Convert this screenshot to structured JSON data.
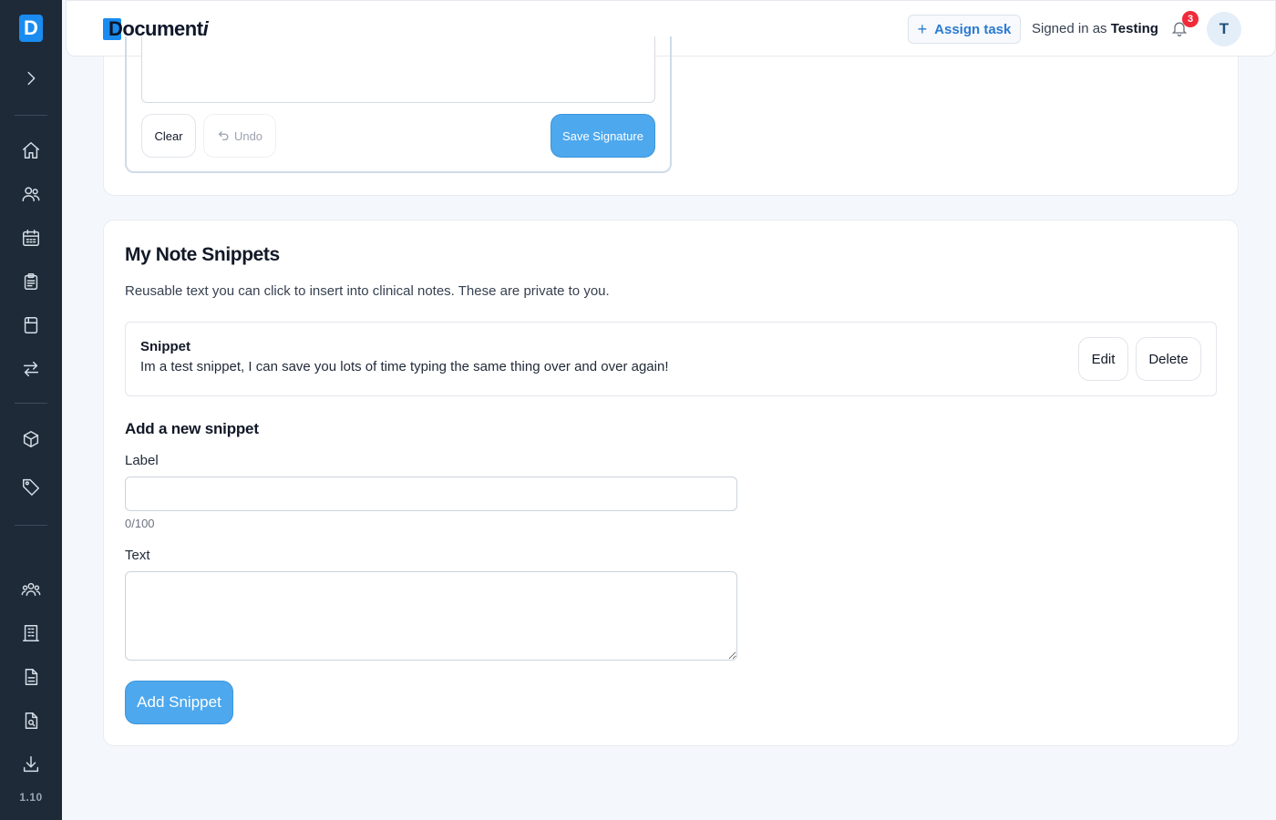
{
  "sidebar": {
    "logo_letter": "D",
    "version": "1.10",
    "icons": [
      "chevron-right-icon",
      "home-icon",
      "users-icon",
      "calendar-icon",
      "clipboard-icon",
      "list-icon",
      "transfer-icon",
      "box-icon",
      "tag-icon",
      "team-icon",
      "building-icon",
      "document-icon",
      "document-search-icon",
      "download-icon"
    ]
  },
  "header": {
    "brand_main": "Document",
    "brand_italic": "i",
    "assign_label": "Assign task",
    "signed_in_prefix": "Signed in as",
    "signed_in_user": "Testing",
    "notification_count": "3",
    "avatar_initial": "T"
  },
  "signature": {
    "clear_label": "Clear",
    "undo_label": "Undo",
    "save_label": "Save Signature"
  },
  "snippets": {
    "title": "My Note Snippets",
    "description": "Reusable text you can click to insert into clinical notes. These are private to you.",
    "items": [
      {
        "label": "Snippet",
        "text": "Im a test snippet, I can save you lots of time typing the same thing over and over again!"
      }
    ],
    "edit_label": "Edit",
    "delete_label": "Delete",
    "add_title": "Add a new snippet",
    "label_field": "Label",
    "label_value": "",
    "char_count": "0/100",
    "text_field": "Text",
    "text_value": "",
    "add_button": "Add Snippet"
  },
  "colors": {
    "sidebar_bg": "#1e2a38",
    "accent": "#4da8ee",
    "brand": "#1a8cf0",
    "badge": "#ef2b3b"
  }
}
